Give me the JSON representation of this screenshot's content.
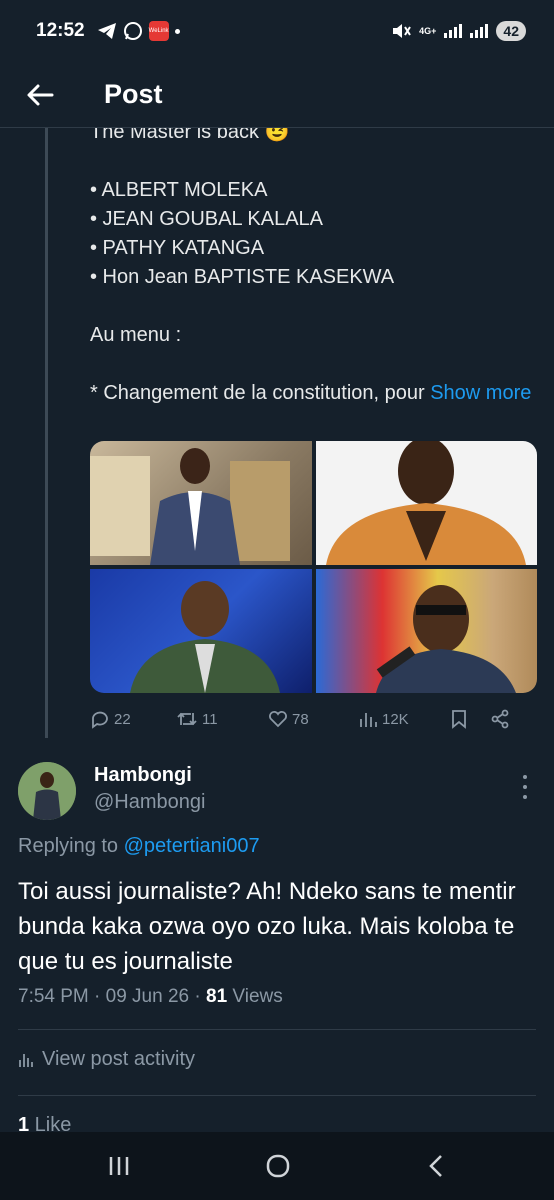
{
  "status": {
    "time": "12:52",
    "network": "4G+",
    "battery": "42",
    "app_badge": "WeLink"
  },
  "header": {
    "title": "Post"
  },
  "post": {
    "text": "The Master is back 😉\n\n• ALBERT MOLEKA\n• JEAN GOUBAL KALALA\n• PATHY KATANGA\n• Hon Jean BAPTISTE KASEKWA\n\nAu menu :\n\n* Changement de la constitution, pour ",
    "show_more": "Show more",
    "actions": {
      "replies": "22",
      "reposts": "11",
      "likes": "78",
      "views": "12K"
    }
  },
  "reply": {
    "name": "Hambongi",
    "handle": "@Hambongi",
    "replying_prefix": "Replying to ",
    "replying_to": "@petertiani007",
    "text": "Toi aussi journaliste? Ah! Ndeko sans te mentir bunda kaka ozwa oyo ozo luka. Mais koloba te que tu es journaliste",
    "timestamp": "7:54 PM · 09 Jun 26 · ",
    "views_count": "81",
    "views_label": " Views",
    "activity_label": "View post activity",
    "likes_count": "1",
    "likes_label": " Like"
  },
  "colors": {
    "background": "#15202b",
    "accent": "#1d9bf0",
    "muted": "#8b98a5"
  }
}
